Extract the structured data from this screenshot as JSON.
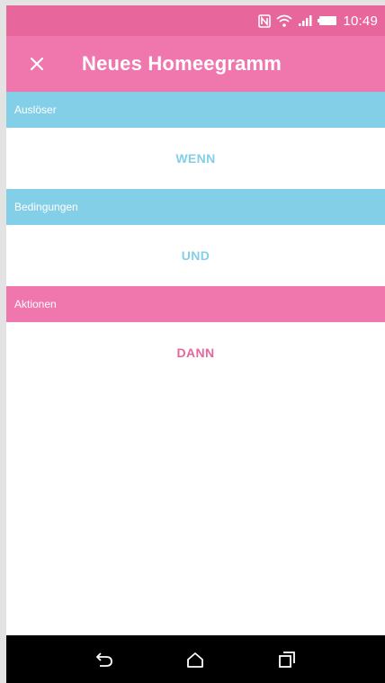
{
  "status_bar": {
    "time": "10:49",
    "icons": [
      "nfc-icon",
      "wifi-icon",
      "signal-icon",
      "battery-icon"
    ]
  },
  "app_bar": {
    "title": "Neues Homeegramm",
    "close_icon": "close-icon"
  },
  "sections": [
    {
      "header": "Auslöser",
      "action": "WENN",
      "color": "#84cfe8"
    },
    {
      "header": "Bedingungen",
      "action": "UND",
      "color": "#84cfe8"
    },
    {
      "header": "Aktionen",
      "action": "DANN",
      "color": "#ef77ad"
    }
  ],
  "nav_bar": {
    "icons": [
      "back-icon",
      "home-icon",
      "recents-icon"
    ]
  },
  "colors": {
    "status_bar": "#e7669c",
    "app_bar": "#ef77ad",
    "trigger_blue": "#84cfe8",
    "action_pink": "#ef77ad"
  }
}
